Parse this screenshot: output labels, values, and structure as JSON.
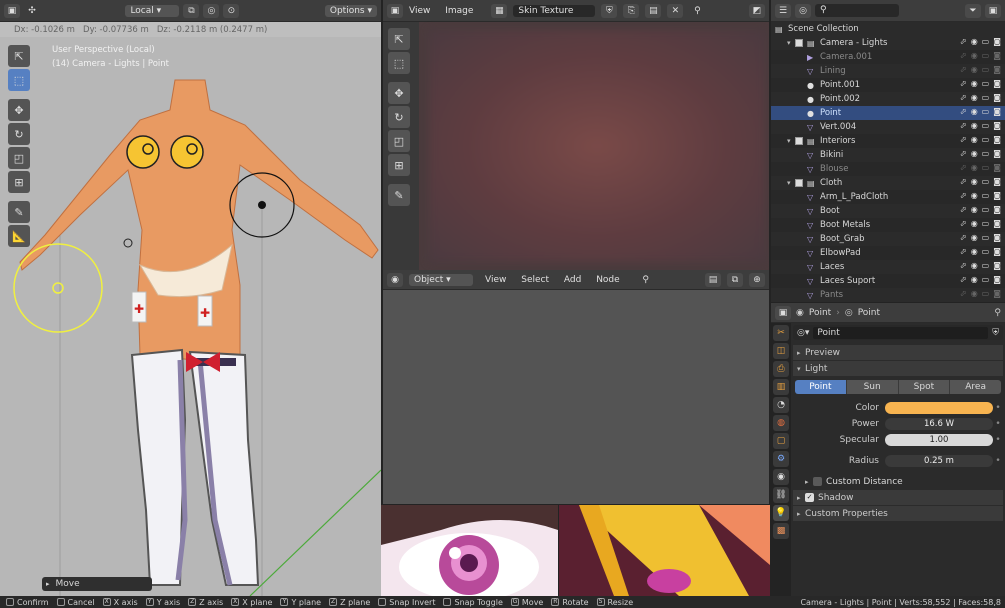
{
  "viewport": {
    "header": {
      "orientation": "Local",
      "options": "Options"
    },
    "transform_readout": "Dx: -0.1026 m   Dy: -0.07736 m   Dz: -0.2118 m (0.2477 m)",
    "overlay_title": "User Perspective (Local)",
    "overlay_subtitle": "(14) Camera - Lights | Point",
    "operator_panel": "Move"
  },
  "image_editor": {
    "menus": [
      "View",
      "Image"
    ],
    "image_name": "Skin Texture"
  },
  "node_editor": {
    "mode": "Object",
    "menus": [
      "View",
      "Select",
      "Add",
      "Node"
    ]
  },
  "outliner": {
    "search_placeholder": "",
    "root": "Scene Collection",
    "rows": [
      {
        "label": "Camera - Lights",
        "kind": "collection",
        "indent": 1,
        "dim": false,
        "sel": false
      },
      {
        "label": "Camera.001",
        "kind": "camera",
        "indent": 2,
        "dim": true,
        "sel": false
      },
      {
        "label": "Lining",
        "kind": "mesh",
        "indent": 2,
        "dim": true,
        "sel": false
      },
      {
        "label": "Point.001",
        "kind": "light",
        "indent": 2,
        "dim": false,
        "sel": false
      },
      {
        "label": "Point.002",
        "kind": "light",
        "indent": 2,
        "dim": false,
        "sel": false
      },
      {
        "label": "Point",
        "kind": "light",
        "indent": 2,
        "dim": false,
        "sel": true
      },
      {
        "label": "Vert.004",
        "kind": "mesh",
        "indent": 2,
        "dim": false,
        "sel": false
      },
      {
        "label": "Interiors",
        "kind": "collection",
        "indent": 1,
        "dim": false,
        "sel": false
      },
      {
        "label": "Bikini",
        "kind": "mesh",
        "indent": 2,
        "dim": false,
        "sel": false
      },
      {
        "label": "Blouse",
        "kind": "mesh",
        "indent": 2,
        "dim": true,
        "sel": false
      },
      {
        "label": "Cloth",
        "kind": "collection",
        "indent": 1,
        "dim": false,
        "sel": false
      },
      {
        "label": "Arm_L_PadCloth",
        "kind": "mesh",
        "indent": 2,
        "dim": false,
        "sel": false
      },
      {
        "label": "Boot",
        "kind": "mesh",
        "indent": 2,
        "dim": false,
        "sel": false
      },
      {
        "label": "Boot Metals",
        "kind": "mesh",
        "indent": 2,
        "dim": false,
        "sel": false
      },
      {
        "label": "Boot_Grab",
        "kind": "mesh",
        "indent": 2,
        "dim": false,
        "sel": false
      },
      {
        "label": "ElbowPad",
        "kind": "mesh",
        "indent": 2,
        "dim": false,
        "sel": false
      },
      {
        "label": "Laces",
        "kind": "mesh",
        "indent": 2,
        "dim": false,
        "sel": false
      },
      {
        "label": "Laces Suport",
        "kind": "mesh",
        "indent": 2,
        "dim": false,
        "sel": false
      },
      {
        "label": "Pants",
        "kind": "mesh",
        "indent": 2,
        "dim": true,
        "sel": false
      }
    ]
  },
  "properties": {
    "breadcrumb_object": "Point",
    "breadcrumb_data": "Point",
    "datablock_name": "Point",
    "panels": {
      "preview": "Preview",
      "light": "Light",
      "custom_distance": "Custom Distance",
      "shadow": "Shadow",
      "custom_properties": "Custom Properties"
    },
    "light_types": [
      "Point",
      "Sun",
      "Spot",
      "Area"
    ],
    "active_type": "Point",
    "fields": {
      "color_label": "Color",
      "color_value": "#f8b450",
      "power_label": "Power",
      "power_value": "16.6 W",
      "specular_label": "Specular",
      "specular_value": "1.00",
      "radius_label": "Radius",
      "radius_value": "0.25 m"
    }
  },
  "statusbar": {
    "items": [
      "Confirm",
      "Cancel",
      "X axis",
      "Y axis",
      "Z axis",
      "X plane",
      "Y plane",
      "Z plane",
      "Snap Invert",
      "Snap Toggle",
      "Move",
      "Rotate",
      "Resize"
    ],
    "keys": [
      "",
      "",
      "X",
      "Y",
      "Z",
      "X",
      "Y",
      "Z",
      "",
      "",
      "G",
      "R",
      "S"
    ],
    "stats": "Camera - Lights | Point | Verts:58,552 | Faces:58,8"
  }
}
